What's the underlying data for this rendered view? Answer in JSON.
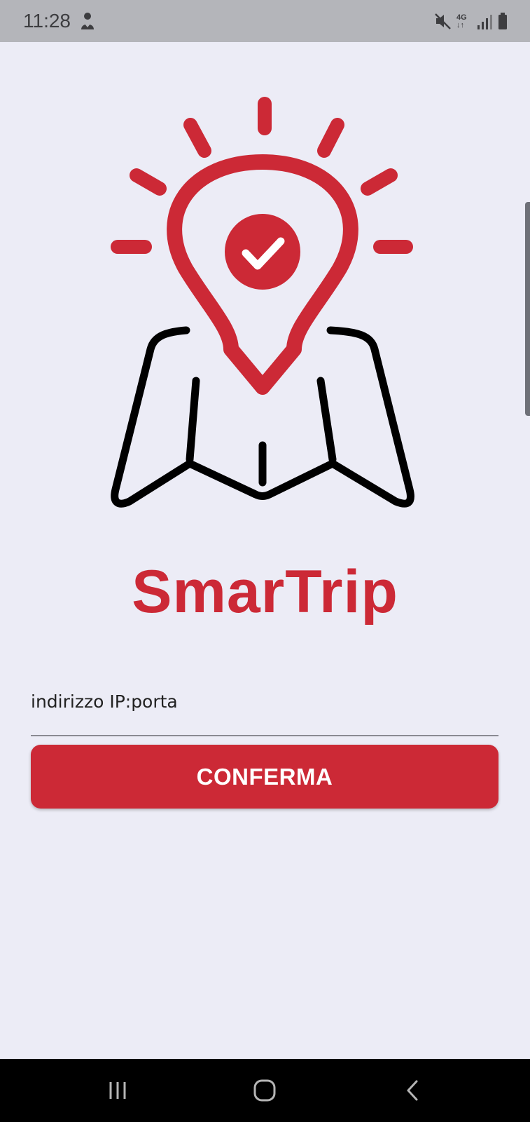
{
  "status_bar": {
    "time": "11:28",
    "network": "4G",
    "icons": [
      "person-icon",
      "mute-icon",
      "signal-icon",
      "battery-icon"
    ]
  },
  "app": {
    "title": "SmarTrip",
    "logo": "map-pin-check-icon"
  },
  "form": {
    "ip_placeholder": "indirizzo IP:porta",
    "ip_value": "",
    "confirm_label": "CONFERMA"
  },
  "nav": {
    "icons": [
      "recent-apps-icon",
      "home-icon",
      "back-icon"
    ]
  },
  "colors": {
    "accent": "#CC2936",
    "background": "#ECECF6",
    "status_bar": "#B4B5BA",
    "nav_bar": "#000000"
  }
}
